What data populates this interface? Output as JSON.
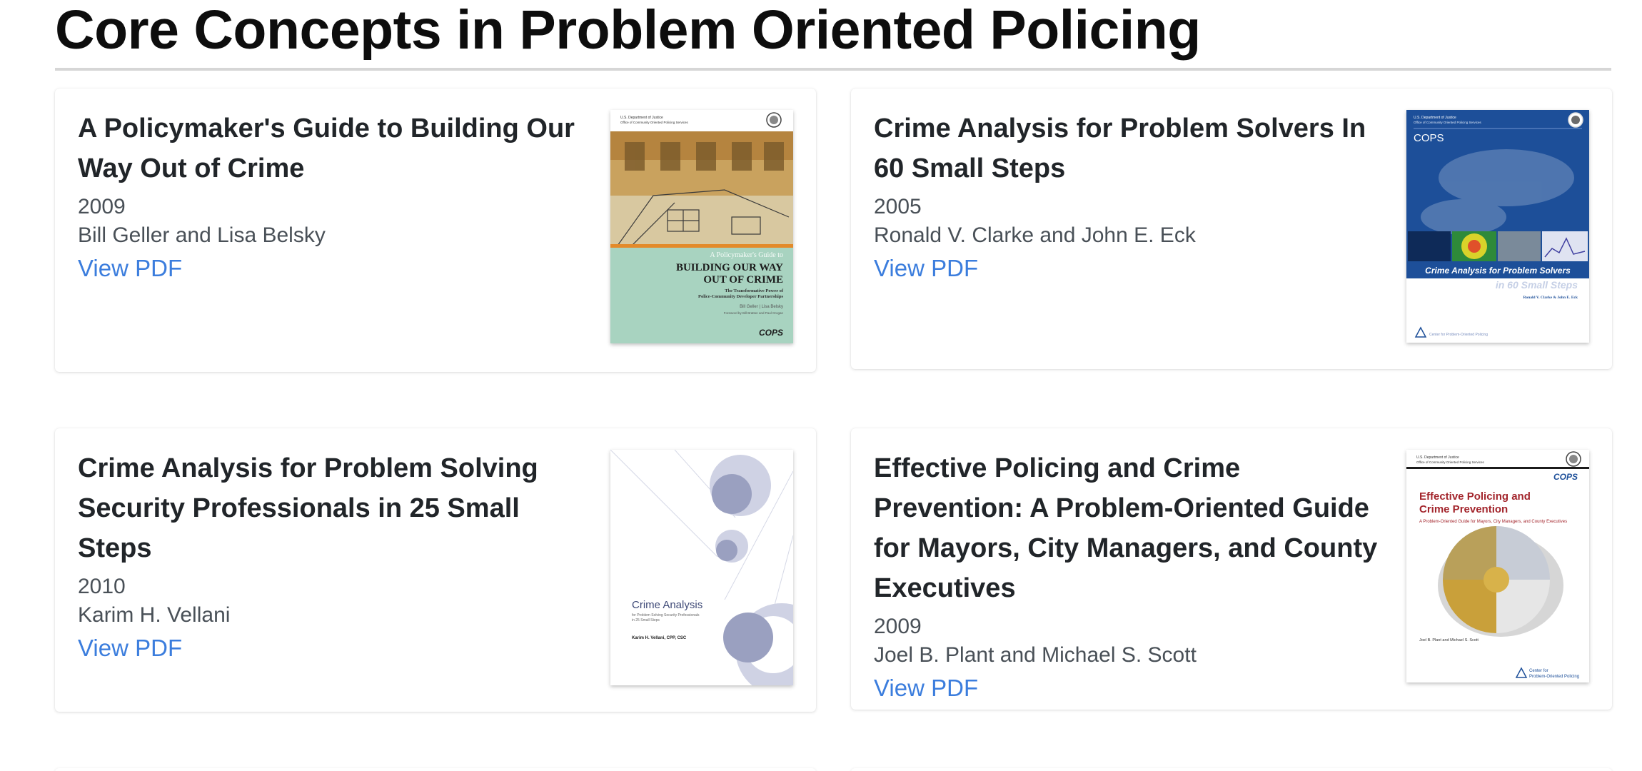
{
  "page": {
    "title": "Core Concepts in Problem Oriented Policing"
  },
  "cards": [
    {
      "title": "A Policymaker's Guide to Building Our Way Out of Crime",
      "year": "2009",
      "authors": "Bill Geller and Lisa Belsky",
      "link": "View PDF",
      "cover": {
        "agency": "U.S. Department of Justice",
        "office": "Office of Community Oriented Policing Services",
        "kicker": "A Policymaker's Guide to",
        "heading_1": "BUILDING OUR WAY",
        "heading_2": "OUT OF CRIME",
        "subtitle_1": "The Transformative Power of",
        "subtitle_2": "Police-Community Developer Partnerships",
        "authors": "Bill Geller | Lisa Belsky",
        "foreword": "Foreword by Bill Bratton and Paul Grogan",
        "logo": "COPS"
      }
    },
    {
      "title": "Crime Analysis for Problem Solvers In 60 Small Steps",
      "year": "2005",
      "authors": "Ronald V. Clarke and John E. Eck",
      "link": "View PDF",
      "cover": {
        "agency": "U.S. Department of Justice",
        "office": "Office of Community Oriented Policing Services",
        "logo": "COPS",
        "banner": "Crime Analysis for Problem Solvers",
        "steps": "in 60 Small Steps",
        "authors": "Ronald V. Clarke & John E. Eck",
        "footer": "Center for Problem-Oriented Policing"
      }
    },
    {
      "title": "Crime Analysis for Problem Solving Security Professionals in 25 Small Steps",
      "year": "2010",
      "authors": "Karim H. Vellani",
      "link": "View PDF",
      "cover": {
        "heading": "Crime Analysis",
        "subtitle_1": "for Problem Solving Security Professionals",
        "subtitle_2": "in 25 Small Steps",
        "authors": "Karim H. Vellani, CPP, CSC"
      }
    },
    {
      "title": "Effective Policing and Crime Prevention: A Problem-Oriented Guide for Mayors, City Managers, and County Executives",
      "year": "2009",
      "authors": "Joel B. Plant and Michael S. Scott",
      "link": "View PDF",
      "cover": {
        "agency": "U.S. Department of Justice",
        "office": "Office of Community Oriented Policing Services",
        "logo": "COPS",
        "heading_1": "Effective Policing and",
        "heading_2": "Crime Prevention",
        "subtitle": "A Problem-Oriented Guide for Mayors, City Managers, and County Executives",
        "authors": "Joel B. Plant and Michael S. Scott",
        "footer_1": "Center for",
        "footer_2": "Problem-Oriented Policing"
      }
    }
  ],
  "colors": {
    "link": "#3b7ddd",
    "title_rule": "#d6d6d6",
    "cover1_band": "#a8d3c0",
    "cover2_blue": "#1d4f99",
    "cover3_circles": "#9aa0c0",
    "cover4_red": "#a3252c"
  }
}
